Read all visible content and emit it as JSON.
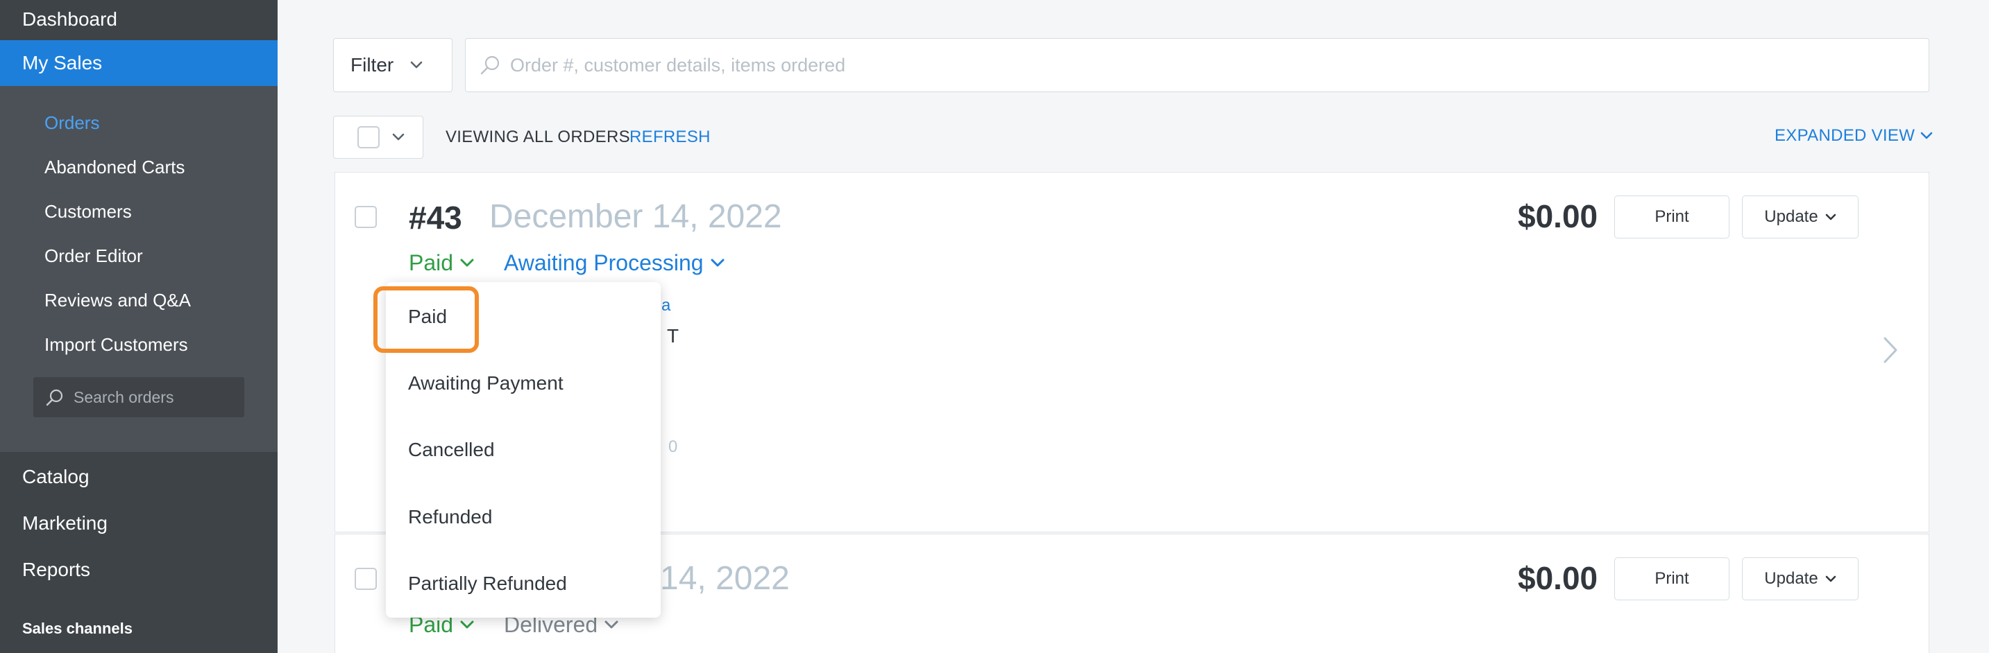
{
  "sidebar": {
    "dashboard": "Dashboard",
    "my_sales": "My Sales",
    "sub_items": [
      "Orders",
      "Abandoned Carts",
      "Customers",
      "Order Editor",
      "Reviews and Q&A",
      "Import Customers"
    ],
    "search_placeholder": "Search orders",
    "catalog": "Catalog",
    "marketing": "Marketing",
    "reports": "Reports",
    "sales_channels": "Sales channels"
  },
  "toolbar": {
    "filter_label": "Filter",
    "search_placeholder": "Order #, customer details, items ordered",
    "viewing_label": "VIEWING ALL ORDERS",
    "refresh_label": "REFRESH",
    "expanded_view_label": "EXPANDED VIEW"
  },
  "orders": [
    {
      "number": "#43",
      "date": "December 14, 2022",
      "payment_status": "Paid",
      "fulfillment_status": "Awaiting Processing",
      "price": "$0.00",
      "print_label": "Print",
      "update_label": "Update"
    },
    {
      "number": "",
      "date": "14, 2022",
      "payment_status": "Paid",
      "fulfillment_status": "Delivered",
      "price": "$0.00",
      "print_label": "Print",
      "update_label": "Update"
    }
  ],
  "obscured_fragments": [
    "ma",
    "T",
    "0"
  ],
  "payment_dropdown": {
    "options": [
      "Paid",
      "Awaiting Payment",
      "Cancelled",
      "Refunded",
      "Partially Refunded"
    ],
    "highlighted_index": 0
  },
  "colors": {
    "accent": "#1e7fdb",
    "paid": "#2f9e44",
    "highlight": "#f38c2b"
  }
}
